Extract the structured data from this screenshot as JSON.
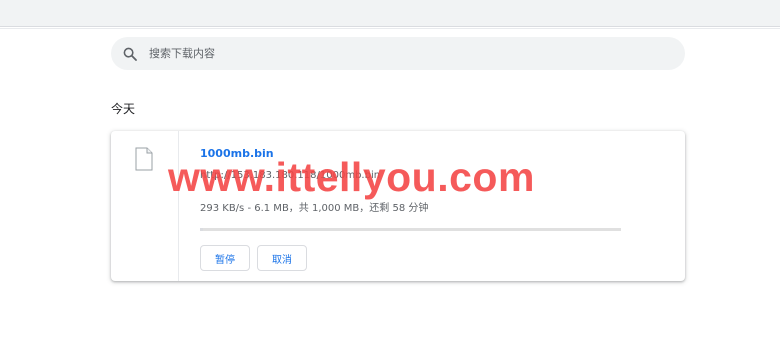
{
  "search": {
    "placeholder": "搜索下载内容"
  },
  "section": {
    "title": "今天"
  },
  "download": {
    "file_name": "1000mb.bin",
    "url": "http://153.183.180.118/1000mb.bin",
    "status": "293 KB/s - 6.1 MB，共 1,000 MB，还剩 58 分钟",
    "progress_fraction": 0.0061,
    "pause_label": "暂停",
    "cancel_label": "取消"
  },
  "watermark": {
    "text": "www.ittellyou.com"
  },
  "colors": {
    "accent": "#1a73e8",
    "watermark": "#f44343",
    "topbar": "#f1f3f4"
  }
}
